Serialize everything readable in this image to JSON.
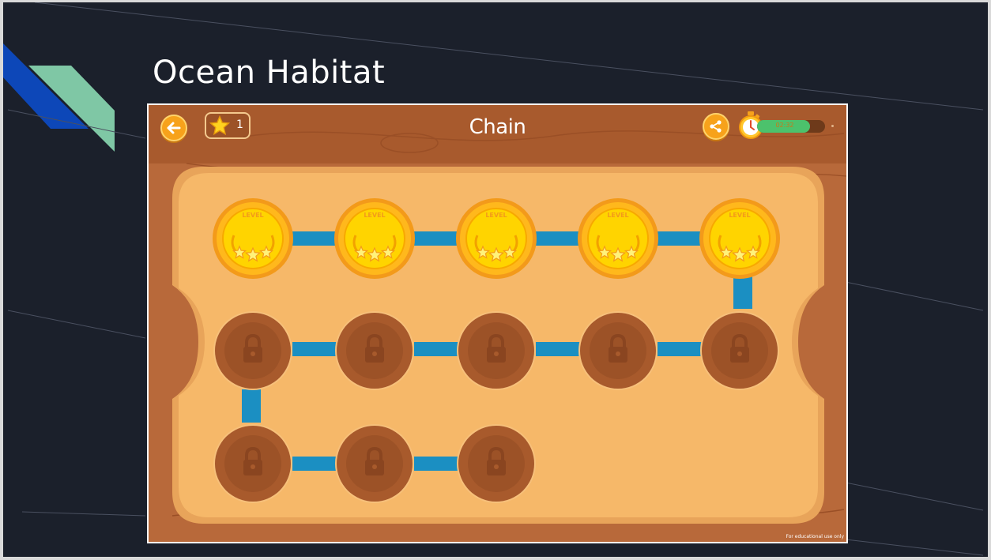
{
  "slide": {
    "title": "Ocean Habitat",
    "accent_colors": [
      "#0d47b8",
      "#7fc7a5"
    ],
    "background": "#1b202b"
  },
  "game": {
    "title": "Chain",
    "header": {
      "back_icon": "arrow-left-icon",
      "star_icon": "star-icon",
      "star_count": "1",
      "share_icon": "share-icon",
      "timer_icon": "stopwatch-icon",
      "timer_text": "02:32",
      "timer_fraction": 0.78
    },
    "levels": [
      {
        "row": 1,
        "order": 1,
        "state": "completed",
        "stars": 3,
        "label": "LEVEL"
      },
      {
        "row": 1,
        "order": 2,
        "state": "completed",
        "stars": 3,
        "label": "LEVEL"
      },
      {
        "row": 1,
        "order": 3,
        "state": "completed",
        "stars": 3,
        "label": "LEVEL"
      },
      {
        "row": 1,
        "order": 4,
        "state": "completed",
        "stars": 3,
        "label": "LEVEL"
      },
      {
        "row": 1,
        "order": 5,
        "state": "completed",
        "stars": 3,
        "label": "LEVEL"
      },
      {
        "row": 2,
        "order": 6,
        "state": "locked",
        "icon": "lock-icon"
      },
      {
        "row": 2,
        "order": 7,
        "state": "locked",
        "icon": "lock-icon"
      },
      {
        "row": 2,
        "order": 8,
        "state": "locked",
        "icon": "lock-icon"
      },
      {
        "row": 2,
        "order": 9,
        "state": "locked",
        "icon": "lock-icon"
      },
      {
        "row": 2,
        "order": 10,
        "state": "locked",
        "icon": "lock-icon"
      },
      {
        "row": 3,
        "order": 11,
        "state": "locked",
        "icon": "lock-icon"
      },
      {
        "row": 3,
        "order": 12,
        "state": "locked",
        "icon": "lock-icon"
      },
      {
        "row": 3,
        "order": 13,
        "state": "locked",
        "icon": "lock-icon"
      }
    ],
    "footer_note": "For educational use only",
    "colors": {
      "wood": "#b8693a",
      "board": "#f6b869",
      "connector": "#1b8fc2",
      "gold": "#f6c200",
      "locked": "#a85a2c"
    }
  }
}
